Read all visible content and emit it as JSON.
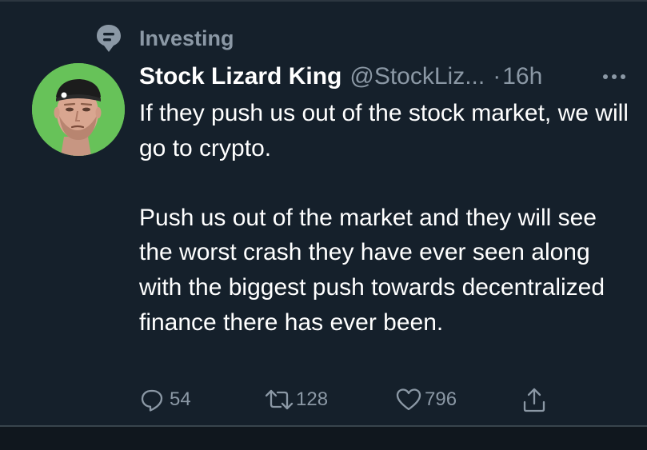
{
  "social_context": {
    "icon": "topic-icon",
    "label": "Investing"
  },
  "author": {
    "display_name": "Stock Lizard King",
    "handle": "@StockLiz...",
    "avatar_bg": "#67c259"
  },
  "meta": {
    "separator": "·",
    "time": "16h",
    "more_icon": "more-options-icon"
  },
  "body": {
    "paragraph_1": "If they push us out of the stock market, we will go to crypto.",
    "paragraph_2": "Push us out of the market and they will see the worst crash they have ever seen along with the biggest push towards decentralized finance there has ever been."
  },
  "actions": {
    "reply_count": "54",
    "retweet_count": "128",
    "like_count": "796"
  },
  "colors": {
    "background": "#15202b",
    "secondary_text": "#8b98a5",
    "primary_text": "#ffffff"
  }
}
